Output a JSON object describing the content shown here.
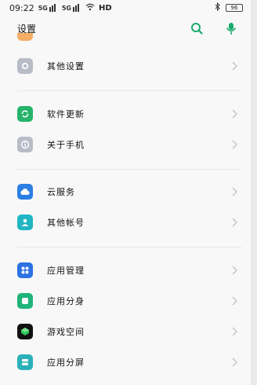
{
  "status_bar": {
    "time": "09:22",
    "signal_1_label": "5G",
    "signal_2_label": "5G",
    "network": "HD",
    "battery": "96"
  },
  "header": {
    "title": "设置",
    "search_icon": "search-icon",
    "mic_icon": "mic-icon"
  },
  "items": [
    {
      "label": "其他设置",
      "icon": "other-settings-icon",
      "color": "#b7bcc7"
    },
    {
      "label": "软件更新",
      "icon": "software-update-icon",
      "color": "#27b36a"
    },
    {
      "label": "关于手机",
      "icon": "about-phone-icon",
      "color": "#b7bcc7"
    },
    {
      "label": "云服务",
      "icon": "cloud-service-icon",
      "color": "#2b7fe3"
    },
    {
      "label": "其他帐号",
      "icon": "other-accounts-icon",
      "color": "#21b6c4"
    },
    {
      "label": "应用管理",
      "icon": "app-management-icon",
      "color": "#2b72e3"
    },
    {
      "label": "应用分身",
      "icon": "app-clone-icon",
      "color": "#1fb47a"
    },
    {
      "label": "游戏空间",
      "icon": "game-space-icon",
      "color": "#0f7c39"
    },
    {
      "label": "应用分屏",
      "icon": "split-screen-icon",
      "color": "#2ab0b8"
    }
  ],
  "colors": {
    "accent_green": "#1aa96c",
    "chevron": "#c3c3c3",
    "background": "#f8f8f8"
  }
}
